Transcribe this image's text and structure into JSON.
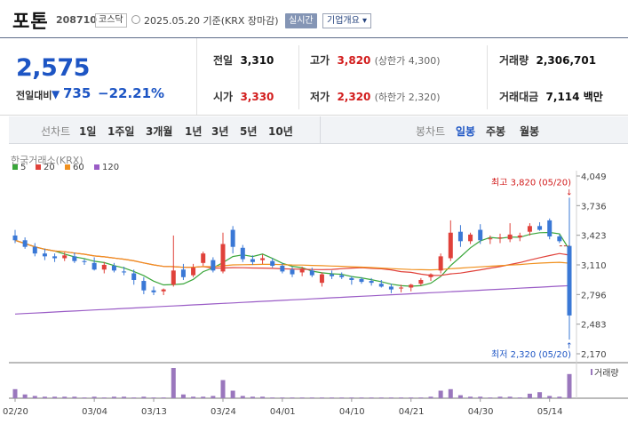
{
  "header": {
    "name": "포톤",
    "code": "208710",
    "market": "코스닥",
    "date": "2025.05.20 기준(KRX 장마감)",
    "realtime": "실시간",
    "corp_info": "기업개요 ▾"
  },
  "quote": {
    "price": "2,575",
    "change_label": "전일대비",
    "change_arrow": "▼",
    "change": "735",
    "change_pct": "−22.21%",
    "prev_close": {
      "label": "전일",
      "value": "3,310"
    },
    "open": {
      "label": "시가",
      "value": "3,330"
    },
    "high": {
      "label": "고가",
      "value": "3,820",
      "sub": "(상한가 4,300)"
    },
    "low": {
      "label": "저가",
      "value": "2,320",
      "sub": "(하한가 2,320)"
    },
    "volume": {
      "label": "거래량",
      "value": "2,306,701"
    },
    "amount": {
      "label": "거래대금",
      "value": "7,114",
      "unit": "백만"
    }
  },
  "tabs": {
    "line_label": "선차트",
    "line_tabs": [
      "1일",
      "1주일",
      "3개월",
      "1년",
      "3년",
      "5년",
      "10년"
    ],
    "candle_label": "봉차트",
    "candle_tabs": [
      "일봉",
      "주봉",
      "월봉"
    ],
    "candle_selected": 0
  },
  "chart_data": {
    "type": "candlestick",
    "source": "한국거래소(KRX)",
    "legend": [
      {
        "name": "5",
        "color": "#3aa63a"
      },
      {
        "name": "20",
        "color": "#e0413a"
      },
      {
        "name": "60",
        "color": "#f0901e"
      },
      {
        "name": "120",
        "color": "#9a5cc6"
      }
    ],
    "colors": {
      "up": "#e0413a",
      "down": "#3a78d6",
      "volume": "#9a77bd"
    },
    "ylim": [
      2170,
      4049
    ],
    "y_ticks": [
      "4,049",
      "3,736",
      "3,423",
      "3,110",
      "2,796",
      "2,483",
      "2,170"
    ],
    "x_ticks": [
      "02/20",
      "03/04",
      "03/13",
      "03/24",
      "04/01",
      "04/10",
      "04/21",
      "04/30",
      "05/14"
    ],
    "high_note": "최고 3,820 (05/20)",
    "low_note": "최저 2,320 (05/20)",
    "volume_label": "거래량",
    "candles": [
      {
        "o": 3420,
        "h": 3480,
        "l": 3340,
        "c": 3370
      },
      {
        "o": 3370,
        "h": 3400,
        "l": 3280,
        "c": 3300
      },
      {
        "o": 3300,
        "h": 3340,
        "l": 3200,
        "c": 3230
      },
      {
        "o": 3230,
        "h": 3280,
        "l": 3160,
        "c": 3200
      },
      {
        "o": 3200,
        "h": 3230,
        "l": 3140,
        "c": 3180
      },
      {
        "o": 3180,
        "h": 3240,
        "l": 3150,
        "c": 3210
      },
      {
        "o": 3200,
        "h": 3240,
        "l": 3130,
        "c": 3150
      },
      {
        "o": 3150,
        "h": 3170,
        "l": 3110,
        "c": 3140
      },
      {
        "o": 3130,
        "h": 3190,
        "l": 3050,
        "c": 3060
      },
      {
        "o": 3060,
        "h": 3140,
        "l": 3020,
        "c": 3110
      },
      {
        "o": 3100,
        "h": 3130,
        "l": 3030,
        "c": 3050
      },
      {
        "o": 3040,
        "h": 3090,
        "l": 3000,
        "c": 3030
      },
      {
        "o": 3020,
        "h": 3060,
        "l": 2900,
        "c": 2950
      },
      {
        "o": 2940,
        "h": 2980,
        "l": 2800,
        "c": 2840
      },
      {
        "o": 2840,
        "h": 2880,
        "l": 2790,
        "c": 2820
      },
      {
        "o": 2830,
        "h": 2860,
        "l": 2790,
        "c": 2850
      },
      {
        "o": 2900,
        "h": 3420,
        "l": 2880,
        "c": 3050
      },
      {
        "o": 3060,
        "h": 3120,
        "l": 2950,
        "c": 2980
      },
      {
        "o": 3000,
        "h": 3120,
        "l": 2980,
        "c": 3080
      },
      {
        "o": 3130,
        "h": 3250,
        "l": 3100,
        "c": 3230
      },
      {
        "o": 3160,
        "h": 3190,
        "l": 3030,
        "c": 3050
      },
      {
        "o": 3040,
        "h": 3450,
        "l": 3020,
        "c": 3330
      },
      {
        "o": 3480,
        "h": 3520,
        "l": 3230,
        "c": 3300
      },
      {
        "o": 3290,
        "h": 3320,
        "l": 3140,
        "c": 3170
      },
      {
        "o": 3170,
        "h": 3210,
        "l": 3110,
        "c": 3140
      },
      {
        "o": 3160,
        "h": 3220,
        "l": 3120,
        "c": 3180
      },
      {
        "o": 3150,
        "h": 3180,
        "l": 3080,
        "c": 3100
      },
      {
        "o": 3100,
        "h": 3130,
        "l": 3020,
        "c": 3040
      },
      {
        "o": 3060,
        "h": 3090,
        "l": 2980,
        "c": 3010
      },
      {
        "o": 3030,
        "h": 3090,
        "l": 2990,
        "c": 3070
      },
      {
        "o": 3050,
        "h": 3080,
        "l": 2980,
        "c": 3000
      },
      {
        "o": 2920,
        "h": 3030,
        "l": 2880,
        "c": 3010
      },
      {
        "o": 3010,
        "h": 3050,
        "l": 2960,
        "c": 2990
      },
      {
        "o": 3000,
        "h": 3030,
        "l": 2960,
        "c": 2980
      },
      {
        "o": 2970,
        "h": 2990,
        "l": 2900,
        "c": 2950
      },
      {
        "o": 2960,
        "h": 2980,
        "l": 2910,
        "c": 2930
      },
      {
        "o": 2940,
        "h": 2970,
        "l": 2890,
        "c": 2920
      },
      {
        "o": 2910,
        "h": 2950,
        "l": 2870,
        "c": 2880
      },
      {
        "o": 2880,
        "h": 2910,
        "l": 2810,
        "c": 2850
      },
      {
        "o": 2860,
        "h": 2900,
        "l": 2820,
        "c": 2870
      },
      {
        "o": 2870,
        "h": 2910,
        "l": 2830,
        "c": 2900
      },
      {
        "o": 2910,
        "h": 2970,
        "l": 2890,
        "c": 2950
      },
      {
        "o": 2980,
        "h": 3020,
        "l": 2940,
        "c": 3010
      },
      {
        "o": 3050,
        "h": 3230,
        "l": 3020,
        "c": 3200
      },
      {
        "o": 3180,
        "h": 3580,
        "l": 3150,
        "c": 3450
      },
      {
        "o": 3460,
        "h": 3530,
        "l": 3300,
        "c": 3360
      },
      {
        "o": 3360,
        "h": 3450,
        "l": 3330,
        "c": 3430
      },
      {
        "o": 3480,
        "h": 3540,
        "l": 3330,
        "c": 3370
      },
      {
        "o": 3380,
        "h": 3420,
        "l": 3330,
        "c": 3390
      },
      {
        "o": 3390,
        "h": 3440,
        "l": 3340,
        "c": 3400
      },
      {
        "o": 3380,
        "h": 3550,
        "l": 3350,
        "c": 3430
      },
      {
        "o": 3400,
        "h": 3450,
        "l": 3360,
        "c": 3420
      },
      {
        "o": 3460,
        "h": 3550,
        "l": 3420,
        "c": 3520
      },
      {
        "o": 3520,
        "h": 3560,
        "l": 3470,
        "c": 3480
      },
      {
        "o": 3580,
        "h": 3600,
        "l": 3380,
        "c": 3410
      },
      {
        "o": 3410,
        "h": 3430,
        "l": 3340,
        "c": 3360
      },
      {
        "o": 3310,
        "h": 3820,
        "l": 2320,
        "c": 2575
      }
    ],
    "volume": [
      12,
      5,
      3,
      2,
      2,
      2,
      2,
      1,
      2,
      1,
      2,
      2,
      1,
      2,
      1,
      1,
      40,
      5,
      2,
      2,
      3,
      24,
      10,
      3,
      2,
      2,
      1,
      1,
      1,
      1,
      1,
      1,
      1,
      1,
      1,
      1,
      1,
      1,
      1,
      1,
      1,
      1,
      2,
      10,
      12,
      4,
      2,
      2,
      1,
      2,
      2,
      1,
      6,
      8,
      3,
      2,
      32
    ]
  }
}
